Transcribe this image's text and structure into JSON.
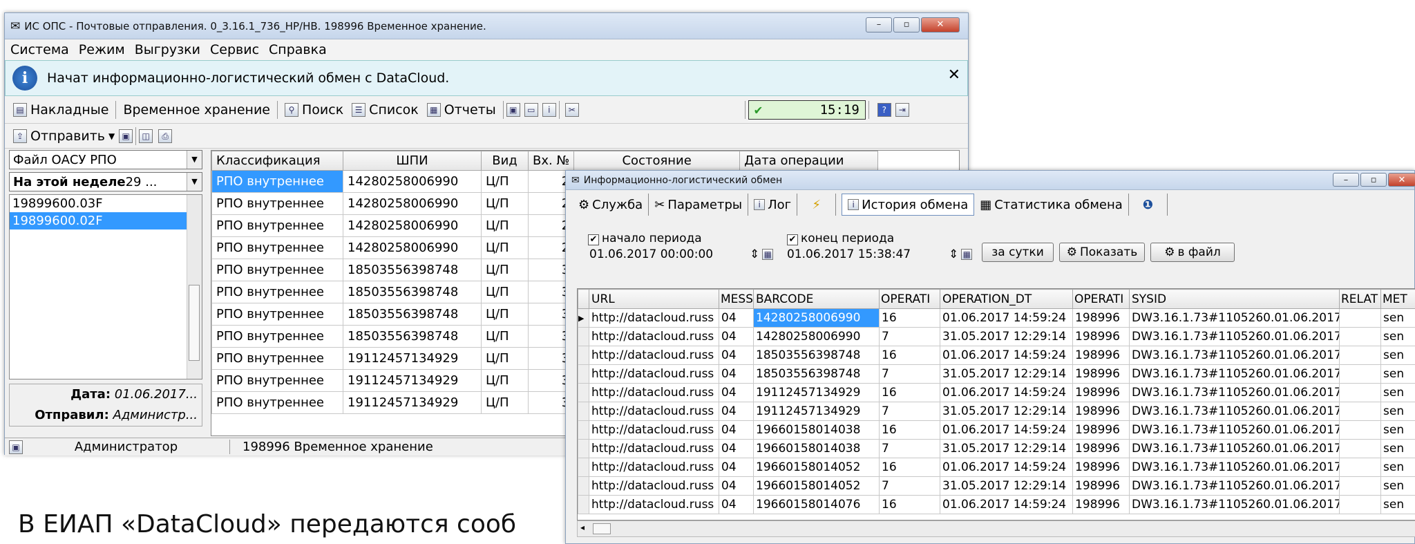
{
  "main_window": {
    "title": "ИС ОПС - Почтовые отправления. 0_3.16.1_736_HP/HB. 198996 Временное хранение.",
    "menu": [
      "Система",
      "Режим",
      "Выгрузки",
      "Сервис",
      "Справка"
    ],
    "info_message": "Начат информационно-логистический обмен с DataCloud.",
    "toolbar": {
      "invoices": "Накладные",
      "temp_storage": "Временное хранение",
      "search": "Поиск",
      "list": "Список",
      "reports": "Отчеты",
      "clock": "15:19"
    },
    "send_label": "Отправить",
    "left": {
      "file_combo": "Файл ОАСУ РПО",
      "week_bold": "На этой неделе",
      "week_rest": " 29 ...",
      "files": [
        "19899600.03F",
        "19899600.02F"
      ],
      "date_label": "Дата:",
      "date_value": "01.06.2017...",
      "sender_label": "Отправил:",
      "sender_value": "Администр..."
    },
    "grid": {
      "headers": [
        "Классификация",
        "ШПИ",
        "Вид",
        "Вх. №",
        "Состояние",
        "Дата операции"
      ],
      "rows": [
        [
          "РПО внутреннее",
          "14280258006990",
          "Ц/П",
          "2"
        ],
        [
          "РПО внутреннее",
          "14280258006990",
          "Ц/П",
          "2"
        ],
        [
          "РПО внутреннее",
          "14280258006990",
          "Ц/П",
          "2"
        ],
        [
          "РПО внутреннее",
          "14280258006990",
          "Ц/П",
          "2"
        ],
        [
          "РПО внутреннее",
          "18503556398748",
          "Ц/П",
          "3"
        ],
        [
          "РПО внутреннее",
          "18503556398748",
          "Ц/П",
          "3"
        ],
        [
          "РПО внутреннее",
          "18503556398748",
          "Ц/П",
          "3"
        ],
        [
          "РПО внутреннее",
          "18503556398748",
          "Ц/П",
          "3"
        ],
        [
          "РПО внутреннее",
          "19112457134929",
          "Ц/П",
          "3"
        ],
        [
          "РПО внутреннее",
          "19112457134929",
          "Ц/П",
          "3"
        ],
        [
          "РПО внутреннее",
          "19112457134929",
          "Ц/П",
          "3"
        ]
      ]
    },
    "status": {
      "user": "Администратор",
      "office": "198996 Временное хранение"
    }
  },
  "dialog": {
    "title": "Информационно-логистический обмен",
    "tabs": [
      "Служба",
      "Параметры",
      "Лог",
      "История обмена",
      "Статистика обмена"
    ],
    "period_start_label": "начало периода",
    "period_start_value": "01.06.2017 00:00:00",
    "period_end_label": "конец периода",
    "period_end_value": "01.06.2017 15:38:47",
    "btn_day": "за сутки",
    "btn_show": "Показать",
    "btn_file": "в файл",
    "headers": [
      "URL",
      "MESS",
      "BARCODE",
      "OPERATI",
      "OPERATION_DT",
      "OPERATI",
      "SYSID",
      "RELAT",
      "MET"
    ],
    "rows": [
      [
        "http://datacloud.russ",
        "04",
        "14280258006990",
        "16",
        "01.06.2017 14:59:24",
        "198996",
        "DW3.16.1.73#1105260.01.06.2017",
        "",
        "sen"
      ],
      [
        "http://datacloud.russ",
        "04",
        "14280258006990",
        "7",
        "31.05.2017 12:29:14",
        "198996",
        "DW3.16.1.73#1105260.01.06.2017",
        "",
        "sen"
      ],
      [
        "http://datacloud.russ",
        "04",
        "18503556398748",
        "16",
        "01.06.2017 14:59:24",
        "198996",
        "DW3.16.1.73#1105260.01.06.2017",
        "",
        "sen"
      ],
      [
        "http://datacloud.russ",
        "04",
        "18503556398748",
        "7",
        "31.05.2017 12:29:14",
        "198996",
        "DW3.16.1.73#1105260.01.06.2017",
        "",
        "sen"
      ],
      [
        "http://datacloud.russ",
        "04",
        "19112457134929",
        "16",
        "01.06.2017 14:59:24",
        "198996",
        "DW3.16.1.73#1105260.01.06.2017",
        "",
        "sen"
      ],
      [
        "http://datacloud.russ",
        "04",
        "19112457134929",
        "7",
        "31.05.2017 12:29:14",
        "198996",
        "DW3.16.1.73#1105260.01.06.2017",
        "",
        "sen"
      ],
      [
        "http://datacloud.russ",
        "04",
        "19660158014038",
        "16",
        "01.06.2017 14:59:24",
        "198996",
        "DW3.16.1.73#1105260.01.06.2017",
        "",
        "sen"
      ],
      [
        "http://datacloud.russ",
        "04",
        "19660158014038",
        "7",
        "31.05.2017 12:29:14",
        "198996",
        "DW3.16.1.73#1105260.01.06.2017",
        "",
        "sen"
      ],
      [
        "http://datacloud.russ",
        "04",
        "19660158014052",
        "16",
        "01.06.2017 14:59:24",
        "198996",
        "DW3.16.1.73#1105260.01.06.2017",
        "",
        "sen"
      ],
      [
        "http://datacloud.russ",
        "04",
        "19660158014052",
        "7",
        "31.05.2017 12:29:14",
        "198996",
        "DW3.16.1.73#1105260.01.06.2017",
        "",
        "sen"
      ],
      [
        "http://datacloud.russ",
        "04",
        "19660158014076",
        "16",
        "01.06.2017 14:59:24",
        "198996",
        "DW3.16.1.73#1105260.01.06.2017",
        "",
        "sen"
      ]
    ]
  },
  "caption": "В ЕИАП «DataCloud» передаются сооб"
}
